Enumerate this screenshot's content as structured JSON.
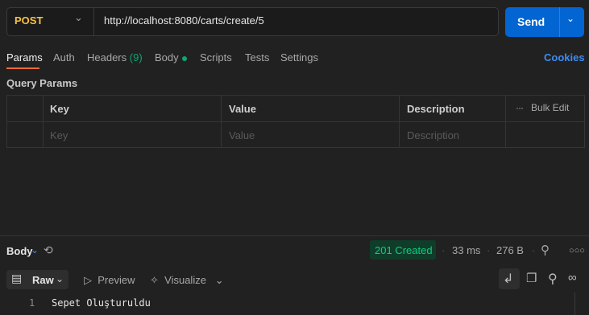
{
  "request": {
    "method": "POST",
    "url": "http://localhost:8080/carts/create/5",
    "send_label": "Send"
  },
  "tabs": [
    {
      "label": "Params"
    },
    {
      "label": "Auth"
    },
    {
      "label": "Headers",
      "count": "(9)"
    },
    {
      "label": "Body"
    },
    {
      "label": "Scripts"
    },
    {
      "label": "Tests"
    },
    {
      "label": "Settings"
    }
  ],
  "cookies_label": "Cookies",
  "query_params": {
    "title": "Query Params",
    "columns": [
      "Key",
      "Value",
      "Description"
    ],
    "bulk_edit": "Bulk Edit",
    "placeholders": [
      "Key",
      "Value",
      "Description"
    ]
  },
  "response": {
    "body_label": "Body",
    "status": "201 Created",
    "time": "33 ms",
    "size": "276 B",
    "status_color": "#0ccf7f"
  },
  "view_modes": {
    "raw": "Raw",
    "preview": "Preview",
    "visualize": "Visualize"
  },
  "response_body": {
    "line": "1",
    "content": "Sepet Oluşturuldu"
  },
  "colors": {
    "method": "#f6c445",
    "accent": "#0265d2",
    "active_tab": "#f26b3a",
    "link": "#3e8cf0"
  },
  "icons": [
    "chevron-down-icon",
    "history-icon",
    "globe-icon",
    "more-icon",
    "raw-icon",
    "play-icon",
    "visualize-icon",
    "wrap-icon",
    "copy-icon",
    "search-icon",
    "link-icon"
  ]
}
